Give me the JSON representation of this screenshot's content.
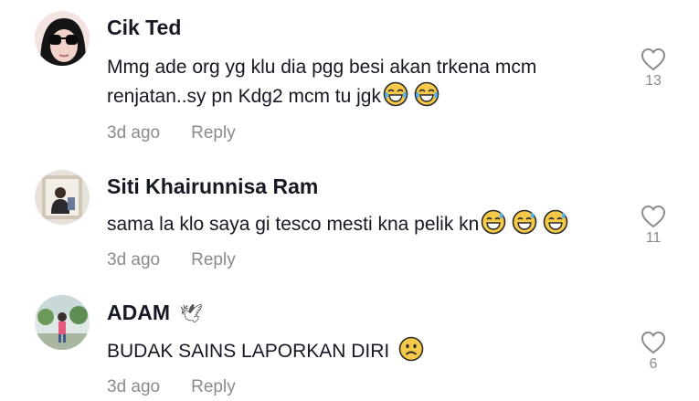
{
  "comments": [
    {
      "author": "Cik Ted",
      "text_line1": "Mmg ade org yg klu dia pgg besi akan trkena mcm",
      "text_line2": "renjatan..sy pn Kdg2 mcm tu jgk",
      "emojis": [
        "laughing-tears-emoji",
        "laughing-tears-emoji"
      ],
      "time": "3d ago",
      "reply_label": "Reply",
      "likes": "13"
    },
    {
      "author": "Siti Khairunnisa Ram",
      "text_line1": "sama la klo saya gi tesco mesti kna pelik kn",
      "emojis": [
        "sweat-smile-emoji",
        "sweat-smile-emoji",
        "sweat-smile-emoji"
      ],
      "time": "3d ago",
      "reply_label": "Reply",
      "likes": "11"
    },
    {
      "author": "ADAM",
      "author_badge": "🕊",
      "text_line1": "BUDAK SAINS LAPORKAN DIRI",
      "emojis": [
        "frowning-face-emoji"
      ],
      "time": "3d ago",
      "reply_label": "Reply",
      "likes": "6"
    }
  ],
  "icons": {
    "like": "heart-outline-icon"
  },
  "colors": {
    "text": "#161823",
    "muted": "#8a8b91",
    "emoji_yellow": "#f7c948"
  }
}
